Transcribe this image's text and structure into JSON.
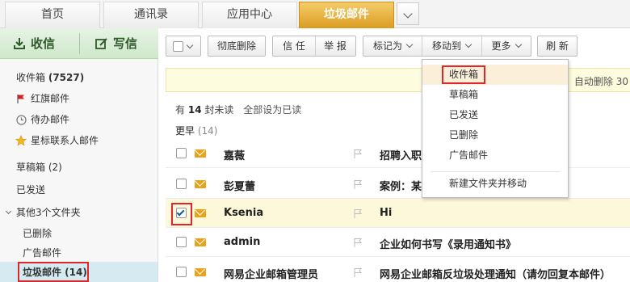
{
  "tabs": [
    {
      "label": "首页"
    },
    {
      "label": "通讯录"
    },
    {
      "label": "应用中心"
    },
    {
      "label": "垃圾邮件"
    }
  ],
  "sidebar": {
    "receive_label": "收信",
    "compose_label": "写信",
    "items": [
      {
        "label": "收件箱",
        "count": "(7527)"
      },
      {
        "label": "红旗邮件"
      },
      {
        "label": "待办邮件"
      },
      {
        "label": "星标联系人邮件"
      },
      {
        "label": "草稿箱 (2)"
      },
      {
        "label": "已发送"
      },
      {
        "label": "其他3个文件夹"
      },
      {
        "label": "已删除"
      },
      {
        "label": "广告邮件"
      },
      {
        "label": "垃圾邮件 (14)"
      }
    ]
  },
  "toolbar": {
    "delete_label": "彻底删除",
    "trust_label": "信 任",
    "report_label": "举 报",
    "mark_label": "标记为",
    "move_label": "移动到",
    "more_label": "更多",
    "refresh_label": "刷 新"
  },
  "notice": {
    "text": "自动删除 30"
  },
  "summary": {
    "prefix": "有",
    "count": "14",
    "suffix": "封未读",
    "mark_all": "全部设为已读"
  },
  "group": {
    "label": "更早",
    "count": "(14)"
  },
  "mails": [
    {
      "sender": "嘉薇",
      "subject": "招聘入职",
      "checked": false
    },
    {
      "sender": "彭夏蕾",
      "subject": "案例：某",
      "checked": false
    },
    {
      "sender": "Ksenia",
      "subject": "Hi",
      "checked": true
    },
    {
      "sender": "admin",
      "subject": "企业如何书写《录用通知书》",
      "checked": false
    },
    {
      "sender": "网易企业邮箱管理员",
      "subject": "网易企业邮箱反垃圾处理通知（请勿回复本邮件）",
      "checked": false
    }
  ],
  "move_menu": {
    "items": [
      "收件箱",
      "草稿箱",
      "已发送",
      "已删除",
      "广告邮件"
    ],
    "new_folder": "新建文件夹并移动"
  },
  "colors": {
    "accent": "#d99b1f",
    "highlight": "#e0262b",
    "sidebar_green": "#cfe8cb"
  }
}
